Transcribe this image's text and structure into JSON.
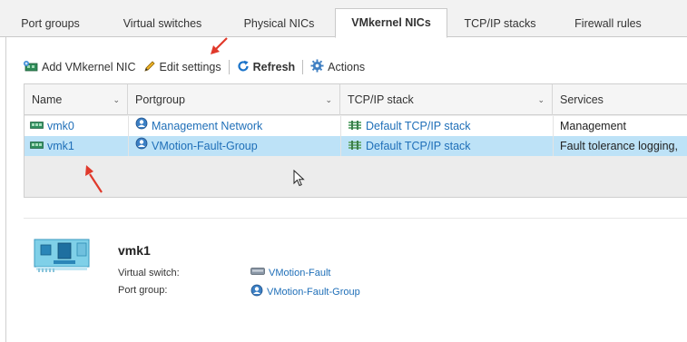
{
  "tabs": [
    {
      "label": "Port groups",
      "active": false
    },
    {
      "label": "Virtual switches",
      "active": false
    },
    {
      "label": "Physical NICs",
      "active": false
    },
    {
      "label": "VMkernel NICs",
      "active": true
    },
    {
      "label": "TCP/IP stacks",
      "active": false
    },
    {
      "label": "Firewall rules",
      "active": false
    }
  ],
  "toolbar": {
    "add_label": "Add VMkernel NIC",
    "edit_label": "Edit settings",
    "refresh_label": "Refresh",
    "actions_label": "Actions"
  },
  "grid": {
    "columns": [
      "Name",
      "Portgroup",
      "TCP/IP stack",
      "Services"
    ],
    "rows": [
      {
        "name": "vmk0",
        "portgroup": "Management Network",
        "stack": "Default TCP/IP stack",
        "services": "Management",
        "selected": false
      },
      {
        "name": "vmk1",
        "portgroup": "VMotion-Fault-Group",
        "stack": "Default TCP/IP stack",
        "services": "Fault tolerance logging,",
        "selected": true
      }
    ]
  },
  "details": {
    "title": "vmk1",
    "virtual_switch_label": "Virtual switch:",
    "virtual_switch_value": "VMotion-Fault",
    "port_group_label": "Port group:",
    "port_group_value": "VMotion-Fault-Group"
  },
  "colors": {
    "selected_row": "#bde2f7",
    "link": "#1f6fb8",
    "annotation_arrow": "#e0392b"
  }
}
